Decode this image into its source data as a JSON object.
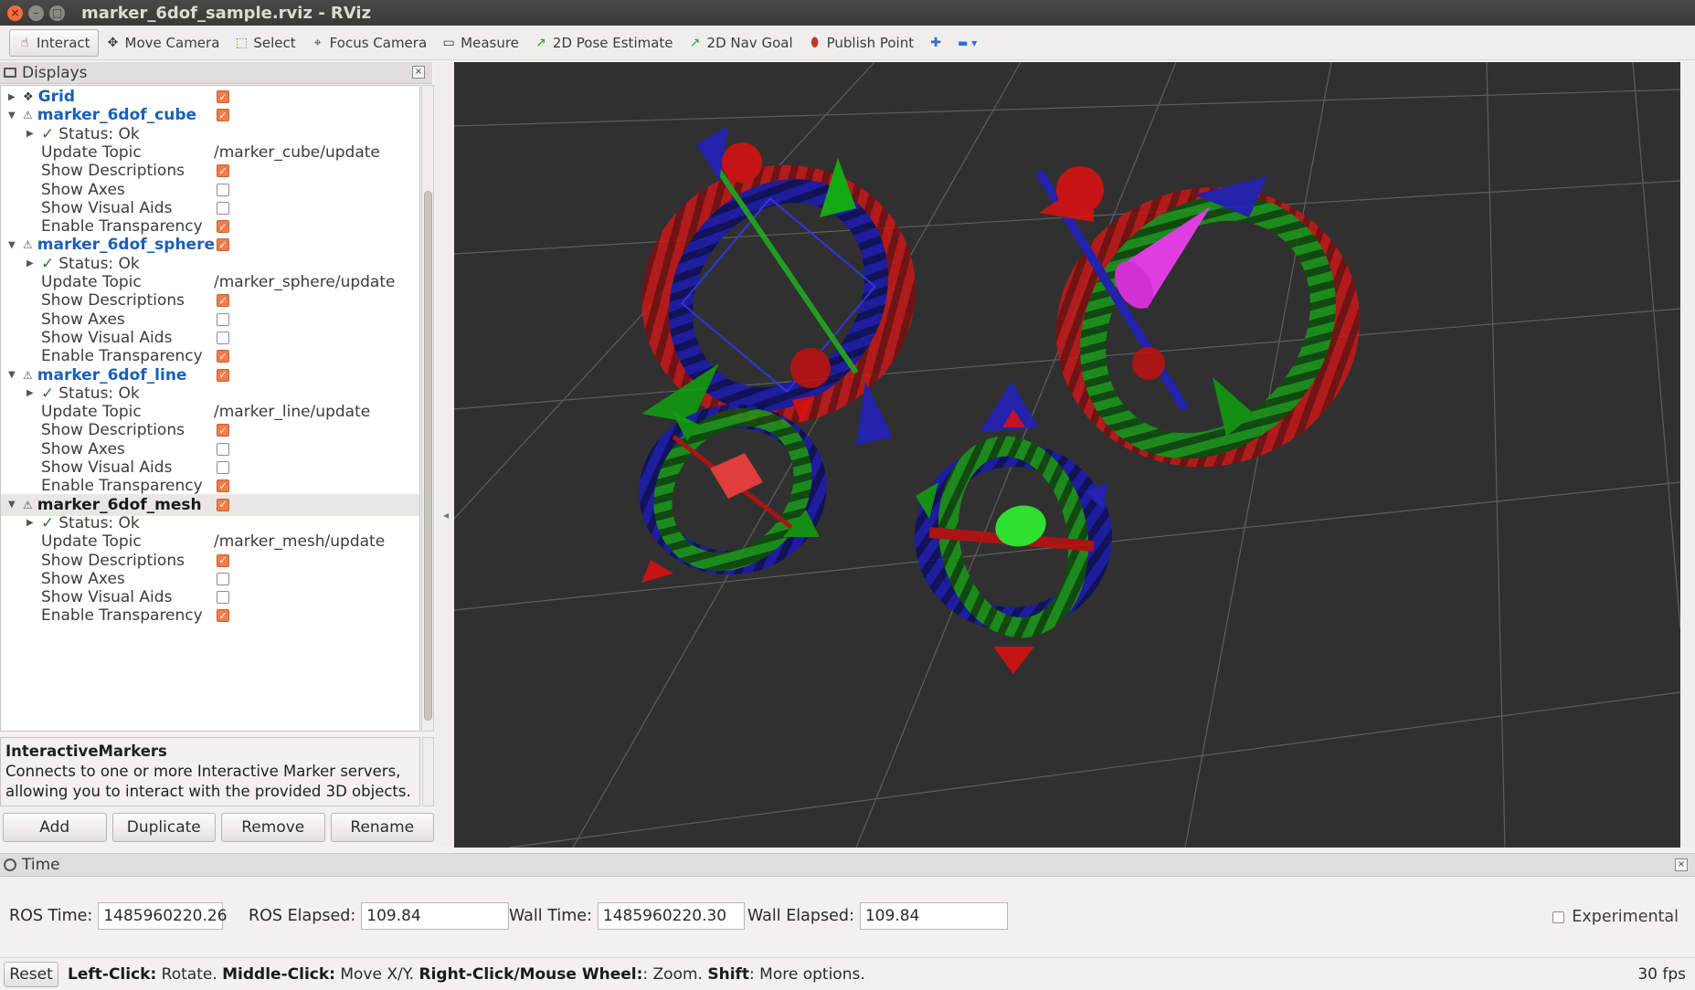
{
  "window": {
    "title": "marker_6dof_sample.rviz - RViz",
    "close": "×",
    "min": "–",
    "max": "□"
  },
  "toolbar": {
    "tools": [
      {
        "label": "Interact",
        "icon": "hand-icon",
        "glyph": "☝",
        "active": true
      },
      {
        "label": "Move Camera",
        "icon": "move-camera-icon",
        "glyph": "✥",
        "active": false
      },
      {
        "label": "Select",
        "icon": "select-icon",
        "glyph": "⬚",
        "active": false
      },
      {
        "label": "Focus Camera",
        "icon": "focus-camera-icon",
        "glyph": "⌖",
        "active": false
      },
      {
        "label": "Measure",
        "icon": "measure-icon",
        "glyph": "▭",
        "active": false
      },
      {
        "label": "2D Pose Estimate",
        "icon": "pose-estimate-icon",
        "glyph": "↗",
        "active": false
      },
      {
        "label": "2D Nav Goal",
        "icon": "nav-goal-icon",
        "glyph": "↗",
        "active": false
      },
      {
        "label": "Publish Point",
        "icon": "publish-point-icon",
        "glyph": "⬮",
        "active": false
      }
    ],
    "add_glyph": "✚",
    "remove_glyph": "▬ ▾"
  },
  "displays": {
    "title": "Displays",
    "close": "×",
    "grid_label": "Grid",
    "markers": [
      {
        "name": "marker_6dof_cube",
        "status": "Status: Ok",
        "topic": "/marker_cube/update",
        "desc": true,
        "axes": false,
        "aids": false,
        "transp": true,
        "selected": false
      },
      {
        "name": "marker_6dof_sphere",
        "status": "Status: Ok",
        "topic": "/marker_sphere/update",
        "desc": true,
        "axes": false,
        "aids": false,
        "transp": true,
        "selected": false
      },
      {
        "name": "marker_6dof_line",
        "status": "Status: Ok",
        "topic": "/marker_line/update",
        "desc": true,
        "axes": false,
        "aids": false,
        "transp": true,
        "selected": false
      },
      {
        "name": "marker_6dof_mesh",
        "status": "Status: Ok",
        "topic": "/marker_mesh/update",
        "desc": true,
        "axes": false,
        "aids": false,
        "transp": true,
        "selected": true
      }
    ],
    "prop_labels": {
      "topic": "Update Topic",
      "desc": "Show Descriptions",
      "axes": "Show Axes",
      "aids": "Show Visual Aids",
      "transp": "Enable Transparency"
    }
  },
  "description": {
    "title": "InteractiveMarkers",
    "text": "Connects to one or more Interactive Marker servers, allowing you to interact with the provided 3D objects."
  },
  "buttons": {
    "add": "Add",
    "duplicate": "Duplicate",
    "remove": "Remove",
    "rename": "Rename"
  },
  "time": {
    "title": "Time",
    "close": "×",
    "ros_time_label": "ROS Time:",
    "ros_time": "1485960220.26",
    "ros_elapsed_label": "ROS Elapsed:",
    "ros_elapsed": "109.84",
    "wall_time_label": "Wall Time:",
    "wall_time": "1485960220.30",
    "wall_elapsed_label": "Wall Elapsed:",
    "wall_elapsed": "109.84",
    "experimental": "Experimental"
  },
  "status": {
    "reset": "Reset",
    "hint": [
      {
        "b": "Left-Click:",
        "t": " Rotate. "
      },
      {
        "b": "Middle-Click:",
        "t": " Move X/Y. "
      },
      {
        "b": "Right-Click/Mouse Wheel:",
        "t": ": Zoom. "
      },
      {
        "b": "Shift",
        "t": ": More options."
      }
    ],
    "fps": "30 fps"
  },
  "colors": {
    "view_bg": "#303030",
    "grid": "#5a5a5a",
    "red": "#e01010",
    "green": "#10c010",
    "blue": "#1010d0",
    "magenta": "#ff30ff"
  }
}
